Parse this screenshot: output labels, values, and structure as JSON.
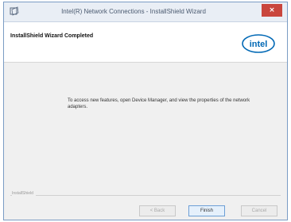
{
  "window": {
    "title": "Intel(R) Network Connections - InstallShield Wizard",
    "close_glyph": "×",
    "app_icon": "installer-icon"
  },
  "header": {
    "title": "InstallShield Wizard Completed",
    "logo_text": "intel",
    "logo_icon": "intel-logo",
    "accent_color": "#0068b5"
  },
  "content": {
    "message": "To access new features, open Device Manager, and view the properties of the network adapters."
  },
  "footer": {
    "brand_label": "InstallShield",
    "back_label": "< Back",
    "finish_label": "Finish",
    "cancel_label": "Cancel"
  }
}
